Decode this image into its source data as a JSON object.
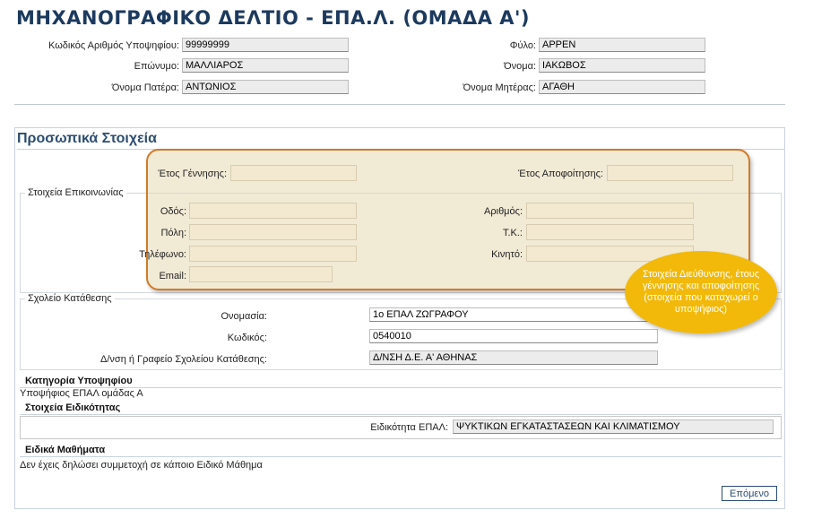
{
  "header": {
    "title": "ΜΗΧΑΝΟΓΡΑΦΙΚΟ ΔΕΛΤΙΟ - ΕΠΑ.Λ. (ΟΜΑΔΑ Α')",
    "candidate_id_label": "Κωδικός Αριθμός Υποψηφίου:",
    "candidate_id_value": "99999999",
    "gender_label": "Φύλο:",
    "gender_value": "ΑΡΡΕΝ",
    "surname_label": "Επώνυμο:",
    "surname_value": "ΜΑΛΛΙΑΡΟΣ",
    "name_label": "Όνομα:",
    "name_value": "ΙΑΚΩΒΟΣ",
    "father_label": "Όνομα Πατέρα:",
    "father_value": "ΑΝΤΩΝΙΟΣ",
    "mother_label": "Όνομα Μητέρας:",
    "mother_value": "ΑΓΑΘΗ"
  },
  "personal": {
    "title": "Προσωπικά Στοιχεία",
    "birth_year_label": "Έτος Γέννησης:",
    "birth_year_value": "",
    "graduation_year_label": "Έτος Αποφοίτησης:",
    "graduation_year_value": ""
  },
  "contact": {
    "legend": "Στοιχεία Επικοινωνίας",
    "street_label": "Οδός:",
    "number_label": "Αριθμός:",
    "city_label": "Πόλη:",
    "postcode_label": "Τ.Κ.:",
    "phone_label": "Τηλέφωνο:",
    "mobile_label": "Κινητό:",
    "email_label": "Email:"
  },
  "school": {
    "legend": "Σχολείο Κατάθεσης",
    "name_label": "Ονομασία:",
    "name_value": "1ο  ΕΠΑΛ  ΖΩΓΡΑΦΟΥ",
    "code_label": "Κωδικός:",
    "code_value": "0540010",
    "directorate_label": "Δ/νση ή Γραφείο Σχολείου Κατάθεσης:",
    "directorate_value": "Δ/ΝΣΗ Δ.Ε. Α' ΑΘΗΝΑΣ"
  },
  "category": {
    "heading": "Κατηγορία Υποψηφίου",
    "value": "Υποψήφιος ΕΠΑΛ ομάδας Α"
  },
  "specialty": {
    "heading": "Στοιχεία Ειδικότητας",
    "label": "Ειδικότητα ΕΠΑΛ:",
    "value": "ΨΥΚΤΙΚΩΝ ΕΓΚΑΤΑΣΤΑΣΕΩΝ ΚΑΙ ΚΛΙΜΑΤΙΣΜΟΥ"
  },
  "special_courses": {
    "heading": "Ειδικά Μαθήματα",
    "text": "Δεν έχεις δηλώσει συμμετοχή σε κάποιο Ειδικό Μάθημα"
  },
  "callout": {
    "text": "Στοιχεία Διεύθυνσης, έτους γέννησης και αποφοίτησης (στοιχεία που καταχωρεί ο υποψήφιος)"
  },
  "buttons": {
    "next": "Επόμενο"
  },
  "colors": {
    "title": "#1c3a5e",
    "highlight_border": "#d07a2a",
    "callout_bg": "#f2b90a"
  }
}
